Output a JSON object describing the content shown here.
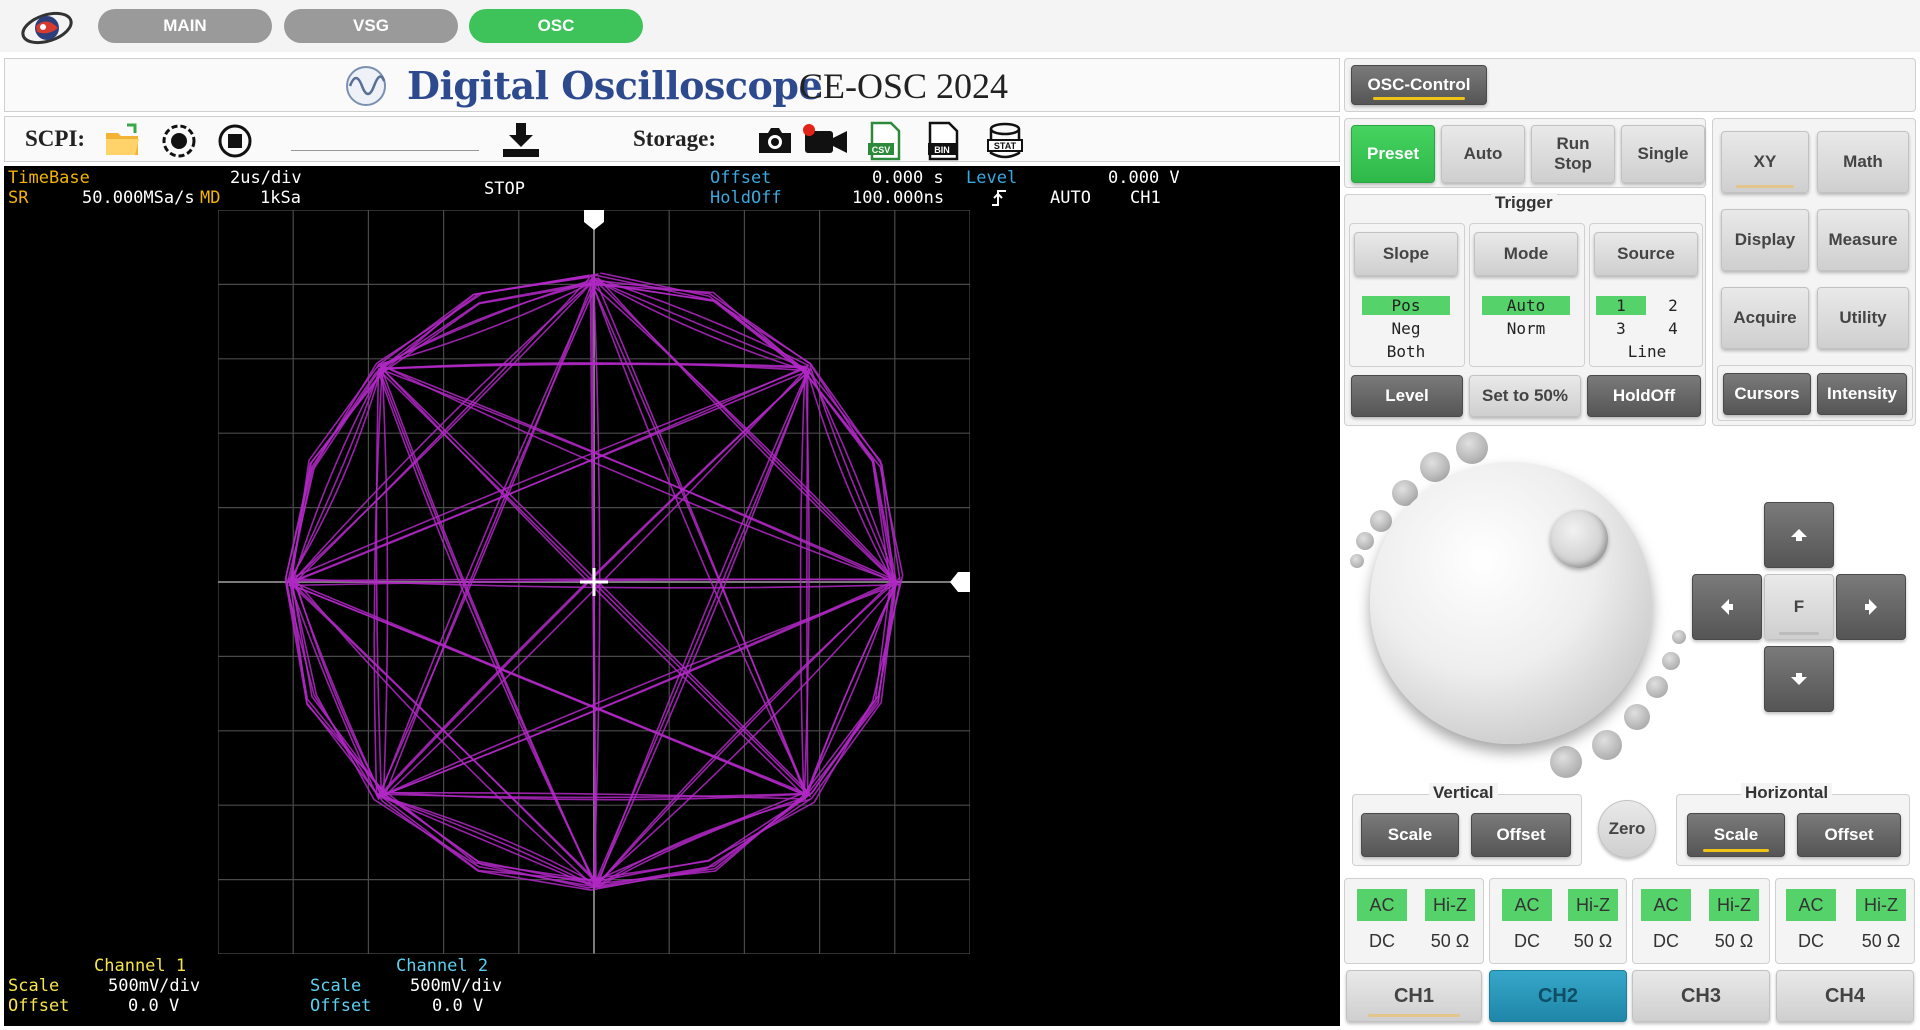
{
  "nav": {
    "tabs": [
      "MAIN",
      "VSG",
      "OSC"
    ],
    "active_tab": "OSC"
  },
  "header": {
    "title": "Digital Oscilloscope",
    "model": "CE-OSC  2024"
  },
  "toolbar": {
    "scpi_label": "SCPI:",
    "storage_label": "Storage:"
  },
  "screen": {
    "timebase_label": "TimeBase",
    "timebase_value": "2us/div",
    "sr_label": "SR",
    "sr_value": "50.000MSa/s",
    "md_label": "MD",
    "md_value": "1kSa",
    "run_state": "STOP",
    "offset_label": "Offset",
    "offset_value": "0.000 s",
    "holdoff_label": "HoldOff",
    "holdoff_value": "100.000ns",
    "level_label": "Level",
    "level_value": "0.000 V",
    "trigger_mode": "AUTO",
    "trigger_source": "CH1",
    "ch1_title": "Channel 1",
    "ch1_scale_label": "Scale",
    "ch1_scale": "500mV/div",
    "ch1_offset_label": "Offset",
    "ch1_offset": "0.0 V",
    "ch2_title": "Channel 2",
    "ch2_scale_label": "Scale",
    "ch2_scale": "500mV/div",
    "ch2_offset_label": "Offset",
    "ch2_offset": "0.0 V",
    "trace_color": "#b228c6"
  },
  "control": {
    "osc_control": "OSC-Control",
    "preset": "Preset",
    "auto": "Auto",
    "run_stop_1": "Run",
    "run_stop_2": "Stop",
    "single": "Single",
    "trigger_group": "Trigger",
    "slope": "Slope",
    "slope_options": [
      "Pos",
      "Neg",
      "Both"
    ],
    "slope_selected": "Pos",
    "mode": "Mode",
    "mode_options": [
      "Auto",
      "Norm"
    ],
    "mode_selected": "Auto",
    "source": "Source",
    "source_options": [
      "1",
      "2",
      "3",
      "4",
      "Line"
    ],
    "source_selected": "1",
    "level": "Level",
    "set50": "Set to 50%",
    "holdoff": "HoldOff",
    "xy": "XY",
    "math": "Math",
    "display": "Display",
    "measure": "Measure",
    "acquire": "Acquire",
    "utility": "Utility",
    "cursors": "Cursors",
    "intensity": "Intensity",
    "f_key": "F",
    "vertical_group": "Vertical",
    "v_scale": "Scale",
    "v_offset": "Offset",
    "zero": "Zero",
    "horizontal_group": "Horizontal",
    "h_scale": "Scale",
    "h_offset": "Offset",
    "coupling": [
      {
        "ac": "AC",
        "dc": "DC",
        "hiz": "Hi-Z",
        "ohm50": "50 Ω"
      },
      {
        "ac": "AC",
        "dc": "DC",
        "hiz": "Hi-Z",
        "ohm50": "50 Ω"
      },
      {
        "ac": "AC",
        "dc": "DC",
        "hiz": "Hi-Z",
        "ohm50": "50 Ω"
      },
      {
        "ac": "AC",
        "dc": "DC",
        "hiz": "Hi-Z",
        "ohm50": "50 Ω"
      }
    ],
    "channels": [
      "CH1",
      "CH2",
      "CH3",
      "CH4"
    ],
    "active_channel": "CH2"
  }
}
